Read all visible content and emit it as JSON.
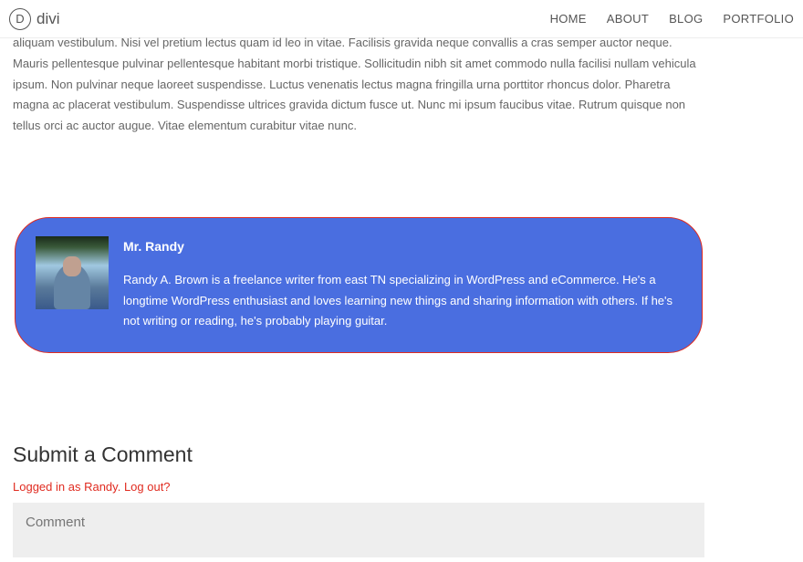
{
  "header": {
    "logo_letter": "D",
    "logo_text": "divi",
    "nav": [
      {
        "label": "HOME"
      },
      {
        "label": "ABOUT"
      },
      {
        "label": "BLOG"
      },
      {
        "label": "PORTFOLIO"
      }
    ]
  },
  "article": {
    "body": "aliquam vestibulum. Nisi vel pretium lectus quam id leo in vitae. Facilisis gravida neque convallis a cras semper auctor neque. Mauris pellentesque pulvinar pellentesque habitant morbi tristique. Sollicitudin nibh sit amet commodo nulla facilisi nullam vehicula ipsum. Non pulvinar neque laoreet suspendisse. Luctus venenatis lectus magna fringilla urna porttitor rhoncus dolor. Pharetra magna ac placerat vestibulum. Suspendisse ultrices gravida dictum fusce ut. Nunc mi ipsum faucibus vitae. Rutrum quisque non tellus orci ac auctor augue. Vitae elementum curabitur vitae nunc."
  },
  "author_box": {
    "name": "Mr. Randy",
    "bio": "Randy A. Brown is a freelance writer from east TN specializing in WordPress and eCommerce. He's a longtime WordPress enthusiast and loves learning new things and sharing information with others. If he's not writing or reading, he's probably playing guitar."
  },
  "comments": {
    "title": "Submit a Comment",
    "login_prefix": "Logged in as ",
    "username": "Randy",
    "separator": ". ",
    "logout_text": "Log out?",
    "placeholder": "Comment"
  }
}
